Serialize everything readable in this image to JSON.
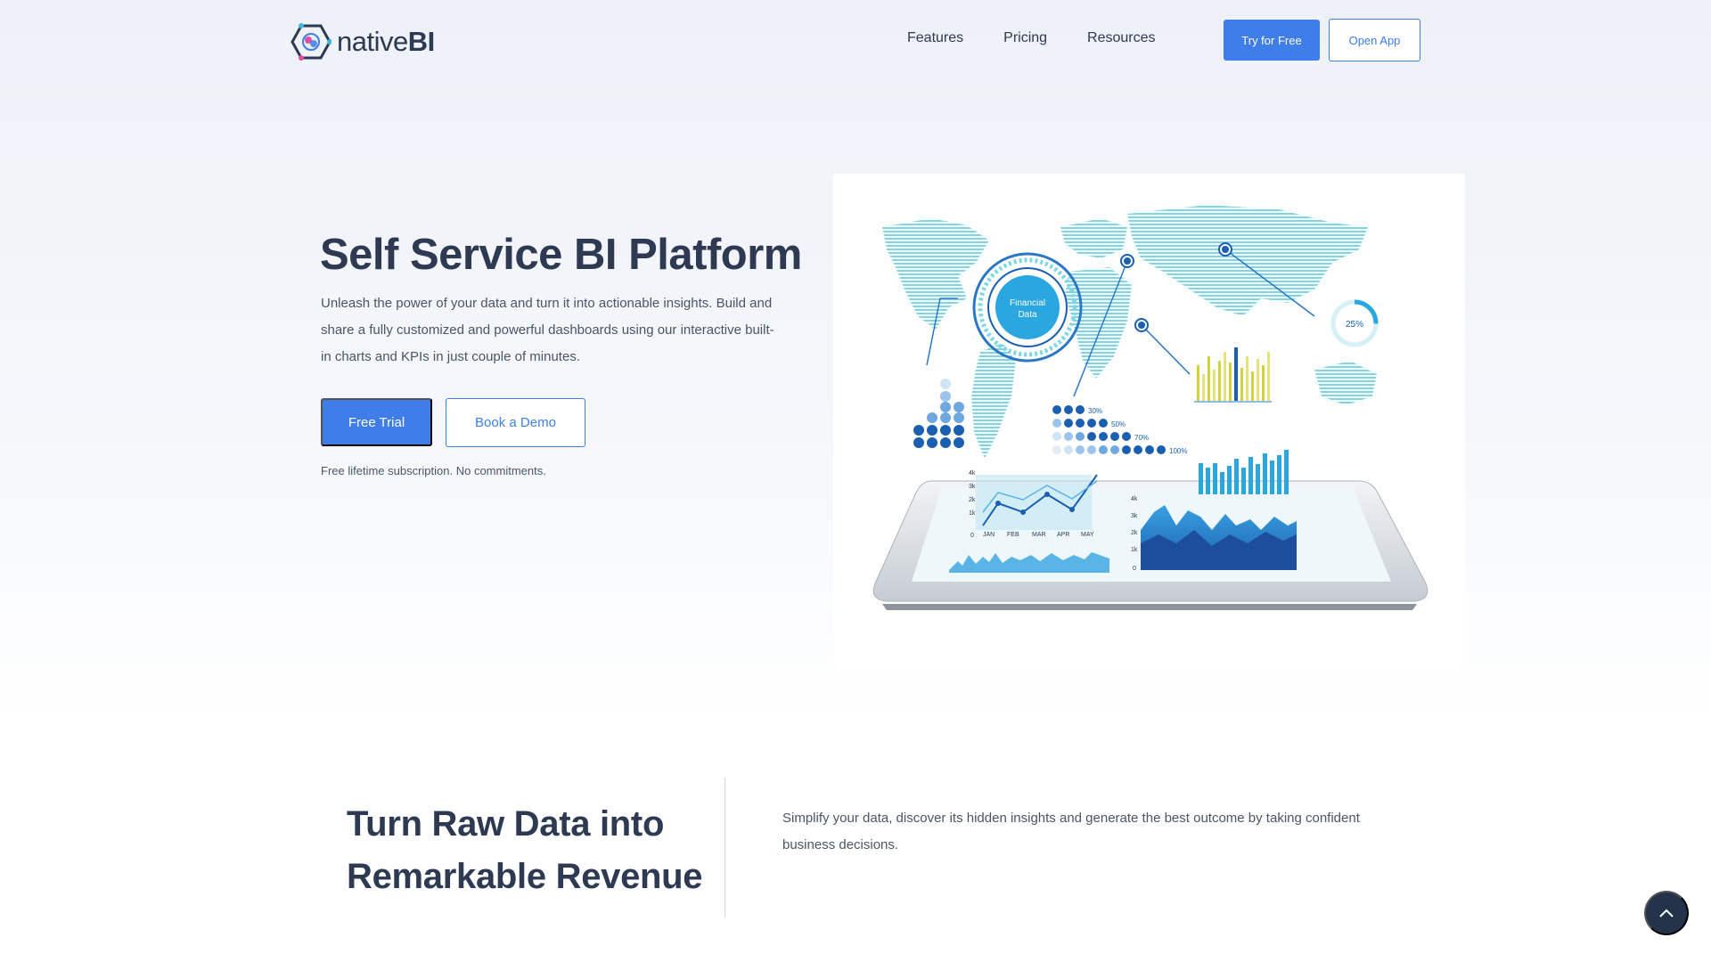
{
  "brand": {
    "name_light": "native",
    "name_bold": "BI"
  },
  "nav": {
    "links": [
      "Features",
      "Pricing",
      "Resources"
    ],
    "try_label": "Try for Free",
    "open_label": "Open App"
  },
  "hero": {
    "title": "Self Service BI Platform",
    "description": "Unleash the power of your data and turn it into actionable insights. Build and share a fully customized and powerful dashboards using our interactive built-in charts and KPIs in just couple of minutes.",
    "trial_label": "Free Trial",
    "demo_label": "Book a Demo",
    "note": "Free lifetime subscription. No commitments."
  },
  "illustration": {
    "circle_label_1": "Financial",
    "circle_label_2": "Data",
    "ring_percent": "25%",
    "percent_rows": [
      "30%",
      "50%",
      "70%",
      "100%"
    ],
    "line_axis_y": [
      "4k",
      "3k",
      "2k",
      "1k",
      "0"
    ],
    "line_axis_x": [
      "JAN",
      "FEB",
      "MAR",
      "APR",
      "MAY"
    ],
    "area_axis_y": [
      "4k",
      "3k",
      "2k",
      "1k",
      "0"
    ]
  },
  "section2": {
    "title_line1": "Turn Raw Data into",
    "title_line2": "Remarkable Revenue",
    "description": "Simplify your data, discover its hidden insights and generate the best outcome by taking confident business decisions."
  },
  "colors": {
    "accent": "#3f7ee8",
    "heading": "#2d3a52",
    "scroll_button": "#24324a"
  }
}
